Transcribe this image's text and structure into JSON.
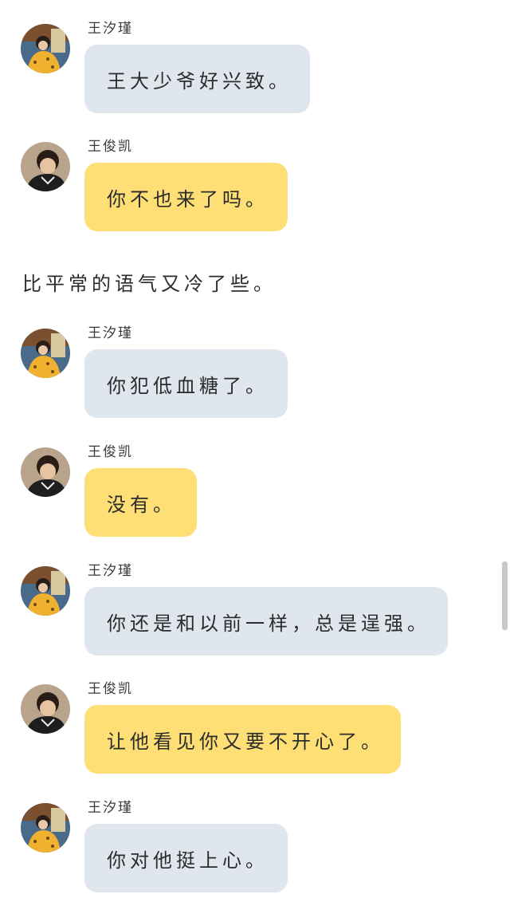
{
  "characters": {
    "wang_xijin": "王汐瑾",
    "wang_junkai": "王俊凯"
  },
  "colors": {
    "bubble_grey": "#e0e6ee",
    "bubble_yellow": "#fedf75"
  },
  "messages": [
    {
      "sender": "王汐瑾",
      "text": "王大少爷好兴致。",
      "style": "grey",
      "avatar": "girl-avatar-icon"
    },
    {
      "sender": "王俊凯",
      "text": "你不也来了吗。",
      "style": "yellow",
      "avatar": "boy-avatar-icon"
    },
    {
      "sender": "王汐瑾",
      "text": "你犯低血糖了。",
      "style": "grey",
      "avatar": "girl-avatar-icon"
    },
    {
      "sender": "王俊凯",
      "text": "没有。",
      "style": "yellow",
      "avatar": "boy-avatar-icon"
    },
    {
      "sender": "王汐瑾",
      "text": "你还是和以前一样，总是逞强。",
      "style": "grey",
      "avatar": "girl-avatar-icon"
    },
    {
      "sender": "王俊凯",
      "text": "让他看见你又要不开心了。",
      "style": "yellow",
      "avatar": "boy-avatar-icon"
    },
    {
      "sender": "王汐瑾",
      "text": "你对他挺上心。",
      "style": "grey",
      "avatar": "girl-avatar-icon"
    }
  ],
  "narration": "比平常的语气又冷了些。"
}
